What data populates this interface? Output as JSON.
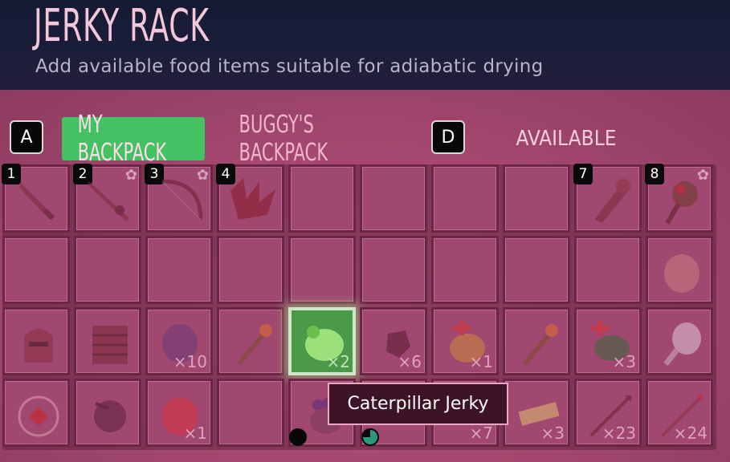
{
  "header": {
    "title": "JERKY RACK",
    "subtitle": "Add available food items suitable for adiabatic drying"
  },
  "tabs": {
    "left_key": "A",
    "right_key": "D",
    "my_backpack": "MY BACKPACK",
    "buggys_backpack": "BUGGY'S BACKPACK",
    "available": "AVAILABLE"
  },
  "hotbar_numbers": [
    "1",
    "2",
    "3",
    "4",
    "7",
    "8"
  ],
  "slots": {
    "r2c3_qty": "×10",
    "r2c5_qty": "×2",
    "r2c6_qty": "×6",
    "r2c7_qty": "×1",
    "r2c9_qty": "×3",
    "r3c3_qty": "×1",
    "r3c7_qty": "×7",
    "r3c8_qty": "×3",
    "r3c9_qty": "×23",
    "r3c10_qty": "×24"
  },
  "tooltip": {
    "text": "Caterpillar Jerky"
  },
  "colors": {
    "selected": "#4a9a4a",
    "panel": "#a3476e",
    "tab_active": "#42c263"
  }
}
